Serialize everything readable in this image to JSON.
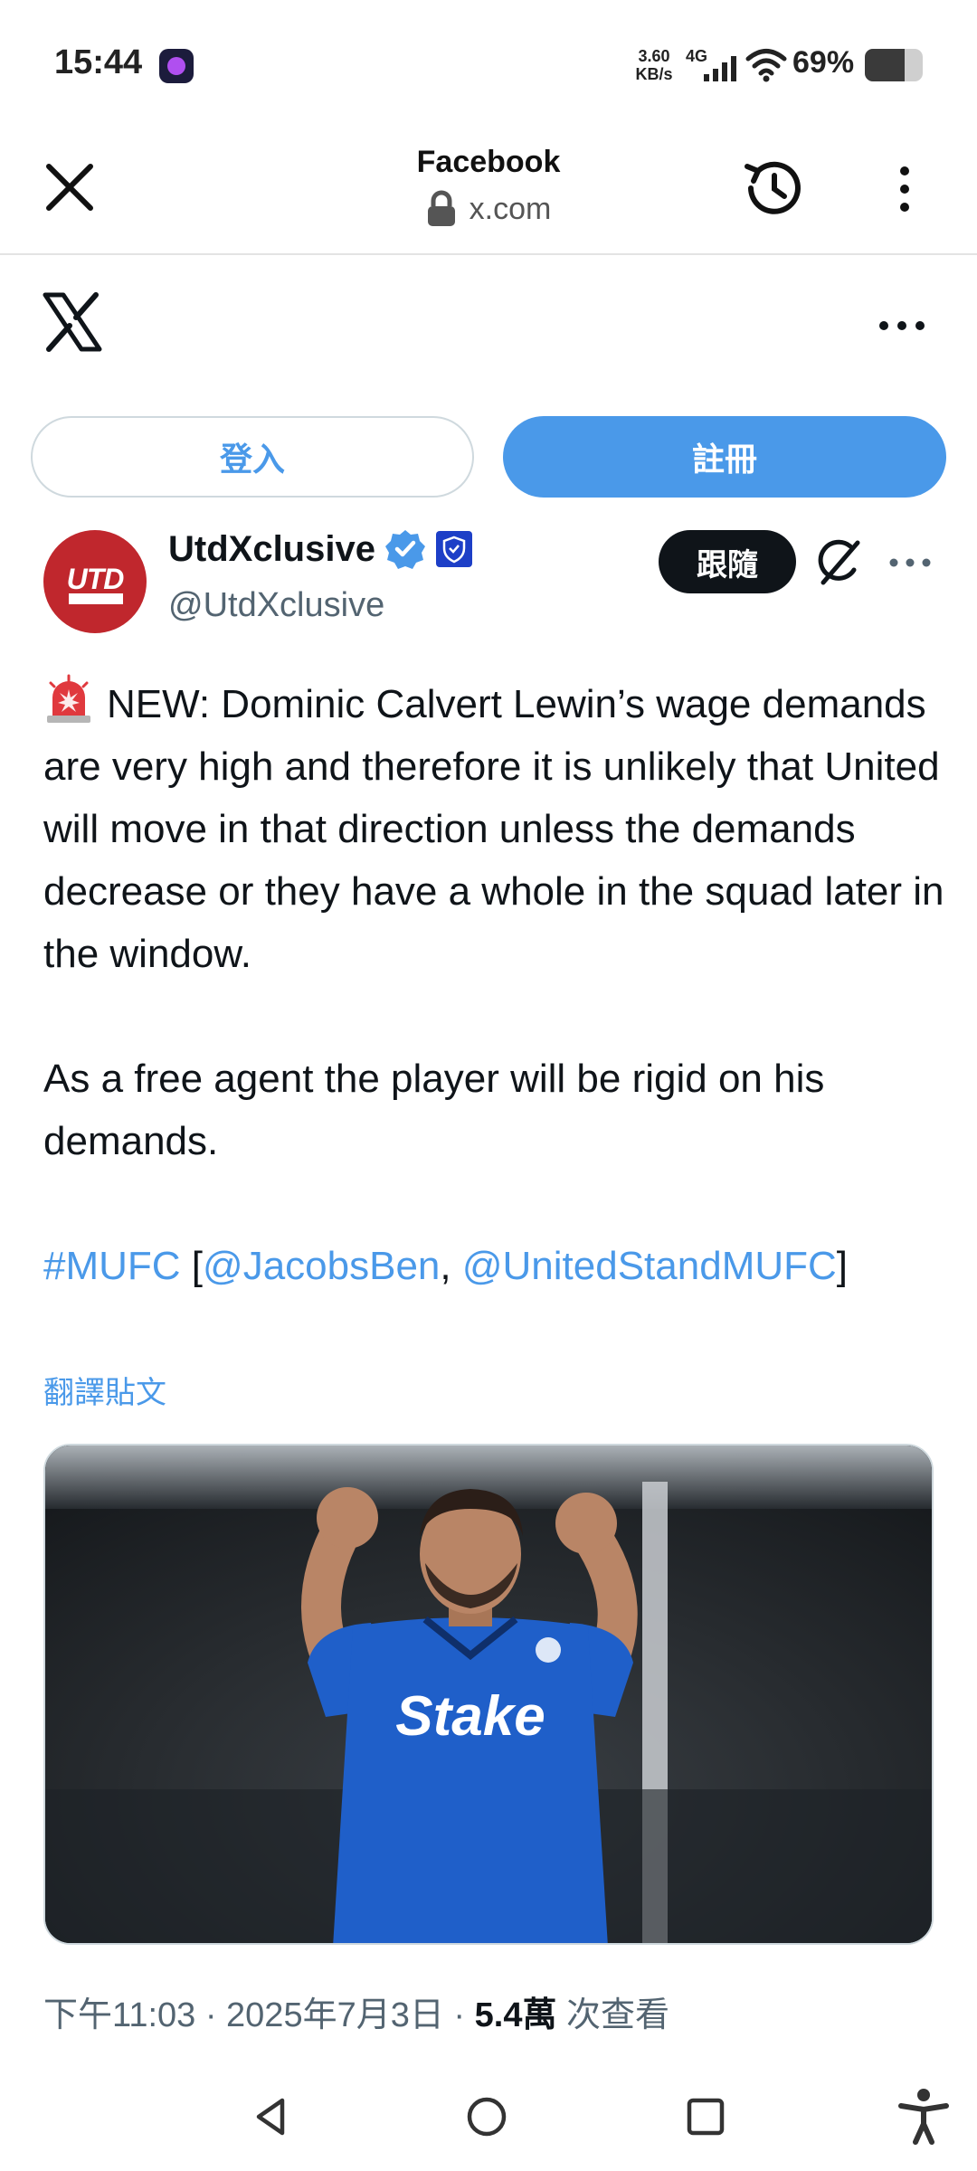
{
  "status_bar": {
    "time": "15:44",
    "speed_value": "3.60",
    "speed_unit": "KB/s",
    "network": "4G",
    "battery_percent": "69%",
    "battery_level": 0.69,
    "icons": [
      "app-notification-icon",
      "signal-icon",
      "wifi-icon",
      "battery-icon"
    ]
  },
  "browser": {
    "title": "Facebook",
    "url": "x.com",
    "icons": [
      "close-icon",
      "lock-icon",
      "history-icon",
      "kebab-menu-icon"
    ]
  },
  "x_header": {
    "icons": [
      "x-logo-icon",
      "more-icon"
    ]
  },
  "auth": {
    "login_label": "登入",
    "signup_label": "註冊"
  },
  "tweet": {
    "author_name": "UtdXclusive",
    "author_handle": "@UtdXclusive",
    "avatar_text": "UTD",
    "follow_label": "跟隨",
    "paragraph1": "NEW: Dominic Calvert Lewin’s wage demands are very high and therefore it is unlikely that United will move in that direction unless the demands decrease or they have a whole in the squad later in the window.",
    "paragraph2": "As a free agent the player will be rigid on his demands.",
    "hashtag": "#MUFC",
    "bracket_open": "[",
    "mention1": "@JacobsBen",
    "separator": ", ",
    "mention2": "@UnitedStandMUFC",
    "bracket_close": "]",
    "translate_label": "翻譯貼文",
    "time": "下午11:03 · 2025年7月3日 · ",
    "views_count": "5.4萬",
    "views_label": " 次查看",
    "icons": [
      "verified-badge-icon",
      "affiliate-badge-icon",
      "grok-icon",
      "more-icon",
      "alarm-icon"
    ]
  },
  "nav": {
    "icons": [
      "back-icon",
      "home-icon",
      "recent-apps-icon",
      "accessibility-icon"
    ]
  },
  "colors": {
    "accent": "#4a99e9",
    "text": "#0f1419",
    "secondary": "#536471",
    "avatar_bg": "#c0272d",
    "jersey": "#1f5fc9"
  }
}
